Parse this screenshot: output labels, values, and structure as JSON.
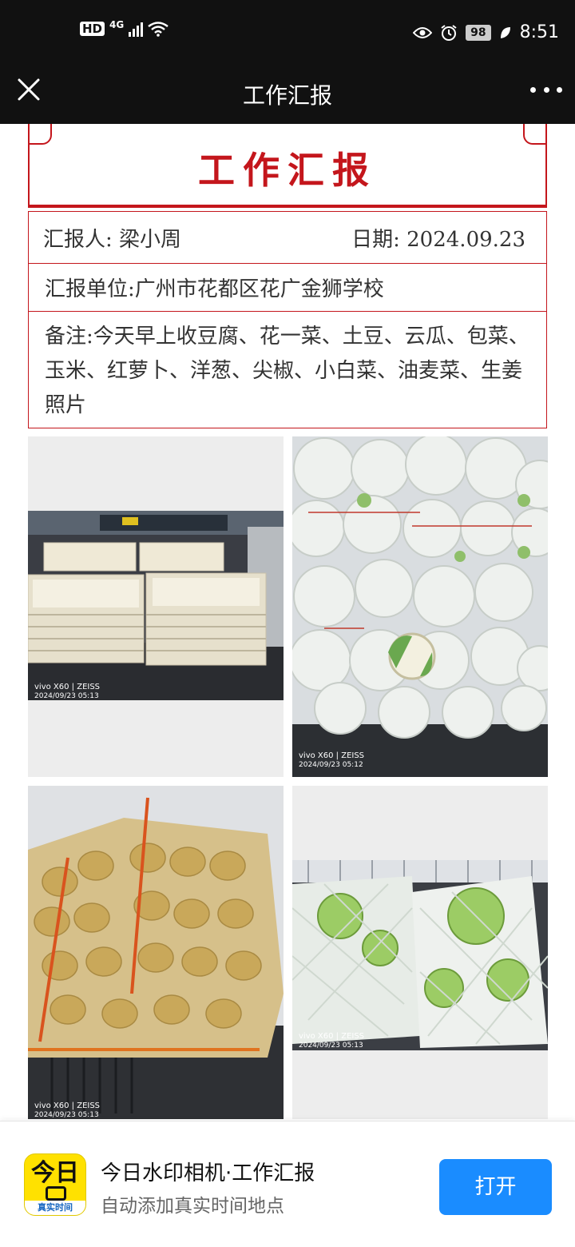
{
  "status_bar": {
    "hd": "HD",
    "network": "4G",
    "battery": "98",
    "time": "8:51"
  },
  "nav": {
    "title": "工作汇报"
  },
  "report": {
    "title": "工作汇报",
    "reporter": "汇报人:  梁小周",
    "date": "日期:  2024.09.23",
    "unit": "汇报单位:广州市花都区花广金狮学校",
    "note": "备注:今天早上收豆腐、花一菜、土豆、云瓜、包菜、玉米、红萝卜、洋葱、尖椒、小白菜、油麦菜、生姜照片"
  },
  "photos": [
    {
      "subject": "tofu trays",
      "watermark_camera": "vivo X60 | ZEISS",
      "watermark_time": "2024/09/23 05:13"
    },
    {
      "subject": "cauliflower bags",
      "watermark_camera": "vivo X60 | ZEISS",
      "watermark_time": "2024/09/23 05:12"
    },
    {
      "subject": "potato sacks",
      "watermark_camera": "vivo X60 | ZEISS",
      "watermark_time": "2024/09/23 05:13"
    },
    {
      "subject": "cabbage bags",
      "watermark_camera": "vivo X60 | ZEISS",
      "watermark_time": "2024/09/23 05:13"
    }
  ],
  "banner": {
    "icon_text": "今日",
    "icon_tag": "真实时间",
    "app_name": "今日水印相机·工作汇报",
    "app_desc": "自动添加真实时间地点",
    "open_label": "打开"
  },
  "colors": {
    "accent_red": "#c4161c",
    "open_button": "#1a8cff",
    "app_icon": "#ffe100"
  }
}
